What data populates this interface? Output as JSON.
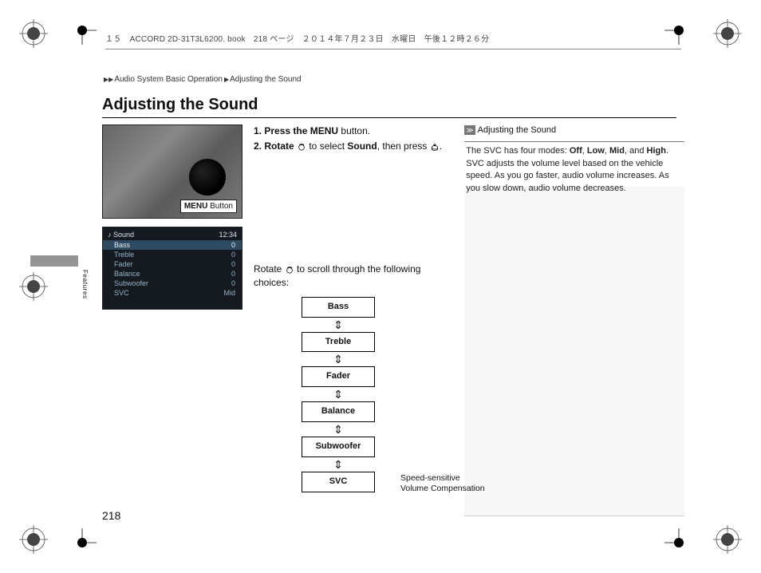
{
  "header": "１５　ACCORD 2D-31T3L6200. book　218 ページ　２０１４年７月２３日　水曜日　午後１２時２６分",
  "breadcrumb": {
    "sep": "▶▶",
    "a": "Audio System Basic Operation",
    "b": "Adjusting the Sound"
  },
  "title": "Adjusting the Sound",
  "side_label": "Features",
  "photo": {
    "menu_label_bold": "MENU",
    "menu_label_rest": " Button"
  },
  "screen": {
    "title": "♪ Sound",
    "clock": "12:34",
    "rows": [
      {
        "name": "Bass",
        "val": "0"
      },
      {
        "name": "Treble",
        "val": "0"
      },
      {
        "name": "Fader",
        "val": "0"
      },
      {
        "name": "Balance",
        "val": "0"
      },
      {
        "name": "Subwoofer",
        "val": "0"
      },
      {
        "name": "SVC",
        "val": "Mid"
      }
    ]
  },
  "steps": {
    "s1_pre": "1. Press the ",
    "s1_bold": "MENU",
    "s1_post": " button.",
    "s2_pre": "2. Rotate ",
    "s2_mid": " to select ",
    "s2_bold": "Sound",
    "s2_post": ", then press ",
    "s2_end": "."
  },
  "rotate_text_pre": "Rotate ",
  "rotate_text_post": " to scroll through the following choices:",
  "flow": [
    "Bass",
    "Treble",
    "Fader",
    "Balance",
    "Subwoofer",
    "SVC"
  ],
  "svc_note": "Speed-sensitive Volume Compensation",
  "sidebar": {
    "marker": "≫",
    "head": "Adjusting the Sound",
    "body_pre": "The SVC has four modes: ",
    "m1": "Off",
    "c": ", ",
    "m2": "Low",
    "m3": "Mid",
    "and": ", and ",
    "m4": "High",
    "body_post": ". SVC adjusts the volume level based on the vehicle speed. As you go faster, audio volume increases. As you slow down, audio volume decreases."
  },
  "page_number": "218"
}
